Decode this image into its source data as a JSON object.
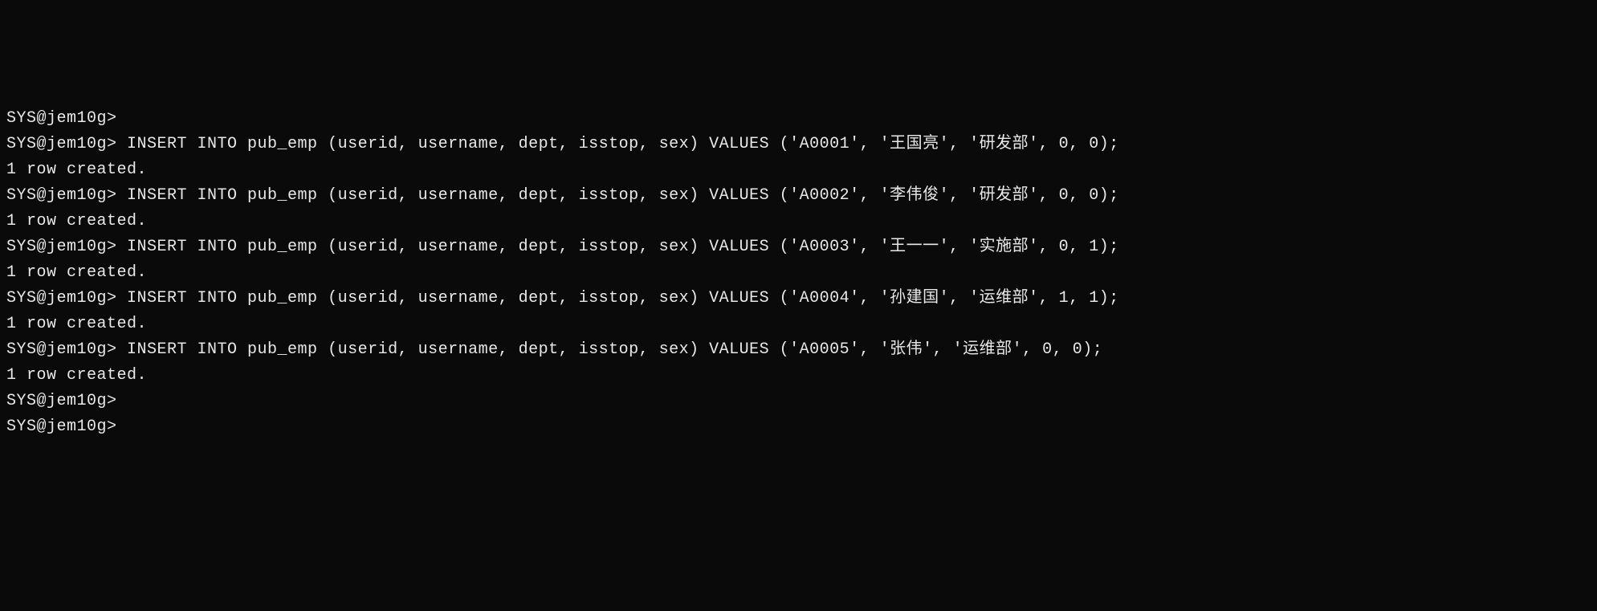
{
  "terminal": {
    "prompt": "SYS@jem10g>",
    "empty_prompt": "SYS@jem10g> ",
    "row_created": "1 row created.",
    "blank": "",
    "lines": [
      {
        "type": "prompt_only",
        "text": "SYS@jem10g>"
      },
      {
        "type": "command",
        "text": "SYS@jem10g> INSERT INTO pub_emp (userid, username, dept, isstop, sex) VALUES ('A0001', '王国亮', '研发部', 0, 0);"
      },
      {
        "type": "blank",
        "text": ""
      },
      {
        "type": "result",
        "text": "1 row created."
      },
      {
        "type": "blank",
        "text": ""
      },
      {
        "type": "command",
        "text": "SYS@jem10g> INSERT INTO pub_emp (userid, username, dept, isstop, sex) VALUES ('A0002', '李伟俊', '研发部', 0, 0);"
      },
      {
        "type": "blank",
        "text": ""
      },
      {
        "type": "result",
        "text": "1 row created."
      },
      {
        "type": "blank",
        "text": ""
      },
      {
        "type": "command",
        "text": "SYS@jem10g> INSERT INTO pub_emp (userid, username, dept, isstop, sex) VALUES ('A0003', '王一一', '实施部', 0, 1);"
      },
      {
        "type": "blank",
        "text": ""
      },
      {
        "type": "result",
        "text": "1 row created."
      },
      {
        "type": "blank",
        "text": ""
      },
      {
        "type": "command",
        "text": "SYS@jem10g> INSERT INTO pub_emp (userid, username, dept, isstop, sex) VALUES ('A0004', '孙建国', '运维部', 1, 1);"
      },
      {
        "type": "blank",
        "text": ""
      },
      {
        "type": "result",
        "text": "1 row created."
      },
      {
        "type": "blank",
        "text": ""
      },
      {
        "type": "command",
        "text": "SYS@jem10g> INSERT INTO pub_emp (userid, username, dept, isstop, sex) VALUES ('A0005', '张伟', '运维部', 0, 0);"
      },
      {
        "type": "blank",
        "text": ""
      },
      {
        "type": "result",
        "text": "1 row created."
      },
      {
        "type": "blank",
        "text": ""
      },
      {
        "type": "prompt_only",
        "text": "SYS@jem10g> "
      },
      {
        "type": "prompt_only",
        "text": "SYS@jem10g>"
      }
    ]
  }
}
